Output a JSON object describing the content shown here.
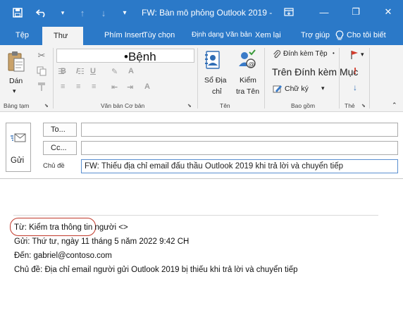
{
  "titlebar": {
    "title": "FW: Bàn mô phỏng Outlook 2019 -",
    "save_icon": "save-icon",
    "undo_icon": "undo-icon",
    "up_icon": "arrow-up-icon",
    "down_icon": "arrow-down-icon",
    "customize_icon": "chevron-down-icon",
    "fullscreen_icon": "ribbon-display-icon",
    "minimize_symbol": "—",
    "restore_symbol": "❐",
    "close_symbol": "✕",
    "bg_color": "#2b79c8"
  },
  "tabs": [
    {
      "label": "Tệp"
    },
    {
      "label": "Thư"
    },
    {
      "label": "Phím Insert"
    },
    {
      "label": "Tùy chọn"
    },
    {
      "label": "Định dạng Văn bản"
    },
    {
      "label": "Xem lại"
    },
    {
      "label": "Trợ giúp"
    },
    {
      "label": "Cho tôi biết"
    }
  ],
  "ribbon": {
    "clipboard": {
      "paste_label": "Dán",
      "group_label": "Bảng tạm"
    },
    "basic_text": {
      "font_box_text": "•Bệnh",
      "group_label": "Văn bản Cơ bản"
    },
    "names": {
      "address_book_line1": "Sổ Địa",
      "address_book_line2": "chỉ",
      "check_names_line1": "Kiểm",
      "check_names_line2": "tra Tên",
      "group_label": "Tên"
    },
    "include": {
      "attach_file": "Đính kèm Tệp",
      "attach_item": "Trên Đính kèm Mục",
      "signature": "Chữ ký",
      "group_label": "Bao gồm"
    },
    "tags": {
      "group_label": "Thẻ"
    }
  },
  "compose": {
    "send_label": "Gửi",
    "to_label": "To...",
    "to_value": "",
    "cc_label": "Cc...",
    "cc_value": "",
    "subject_label": "Chủ đề",
    "subject_value": "FW: Thiếu địa chỉ email đấu thầu Outlook 2019 khi trả lời và chuyển tiếp"
  },
  "body": {
    "from_line": "Từ: Kiểm tra thông tin người <>",
    "sent_line": "Gửi: Thứ tư, ngày 11 tháng 5 năm 2022 9:42 CH",
    "to_line": "Đến: gabriel@contoso.com",
    "subject_line": "Chủ đề: Địa chỉ email người gửi Outlook 2019 bị thiếu khi trả lời và chuyển tiếp",
    "highlight_color": "#c0392b"
  }
}
